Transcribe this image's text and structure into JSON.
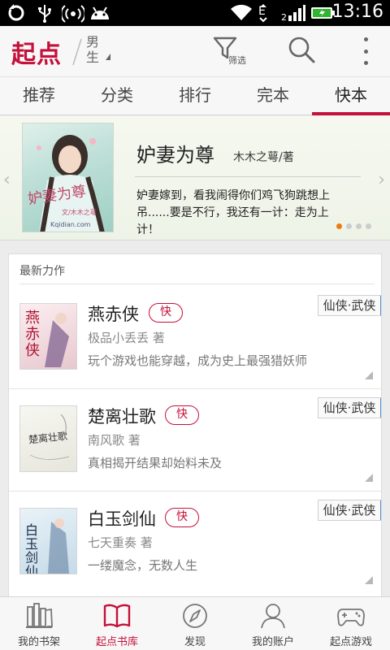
{
  "status_bar": {
    "time": "13:16",
    "icons": [
      "sync-icon",
      "usb-icon",
      "wifi-hotspot-icon",
      "android-icon",
      "wifi-icon",
      "data-e-icon",
      "signal-icon",
      "battery-charging-icon"
    ]
  },
  "app_bar": {
    "logo": "起点",
    "gender": "男生",
    "filter_label": "筛选",
    "icons": [
      "filter-icon",
      "search-icon",
      "more-icon"
    ]
  },
  "tabs": [
    {
      "label": "推荐",
      "active": false
    },
    {
      "label": "分类",
      "active": false
    },
    {
      "label": "排行",
      "active": false
    },
    {
      "label": "完本",
      "active": false
    },
    {
      "label": "快本",
      "active": true
    }
  ],
  "banner": {
    "title": "妒妻为尊",
    "author": "木木之萼/著",
    "description": "妒妻嫁到，看我闹得你们鸡飞狗跳想上吊......要是不行，我还有一计：走为上计！",
    "cover_text": "妒妻为尊",
    "cover_subtext": "文/木木之萼",
    "cover_site": "Kqidian.com",
    "page_count": 4,
    "page_active": 0
  },
  "section": {
    "heading": "最新力作"
  },
  "books": [
    {
      "title": "燕赤侠",
      "badge": "快",
      "author": "极品小丢丢 著",
      "description": "玩个游戏也能穿越，成为史上最强猎妖师",
      "category": "仙侠·武侠",
      "cover_text": "燕赤侠"
    },
    {
      "title": "楚离壮歌",
      "badge": "快",
      "author": "南风歌 著",
      "description": "真相揭开结果却始料未及",
      "category": "仙侠·武侠",
      "cover_text": "楚离壮歌"
    },
    {
      "title": "白玉剑仙",
      "badge": "快",
      "author": "七天重奏 著",
      "description": "一缕魔念，无数人生",
      "category": "仙侠·武侠",
      "cover_text": "白玉剑仙"
    }
  ],
  "bottom_nav": [
    {
      "label": "我的书架",
      "icon": "bookshelf-icon",
      "active": false
    },
    {
      "label": "起点书库",
      "icon": "book-library-icon",
      "active": true
    },
    {
      "label": "发现",
      "icon": "compass-icon",
      "active": false
    },
    {
      "label": "我的账户",
      "icon": "user-icon",
      "active": false
    },
    {
      "label": "起点游戏",
      "icon": "gamepad-icon",
      "active": false
    }
  ],
  "colors": {
    "brand": "#c4103a",
    "indicator_active": "#ee7a12",
    "category_accent": "#4a90d9"
  }
}
